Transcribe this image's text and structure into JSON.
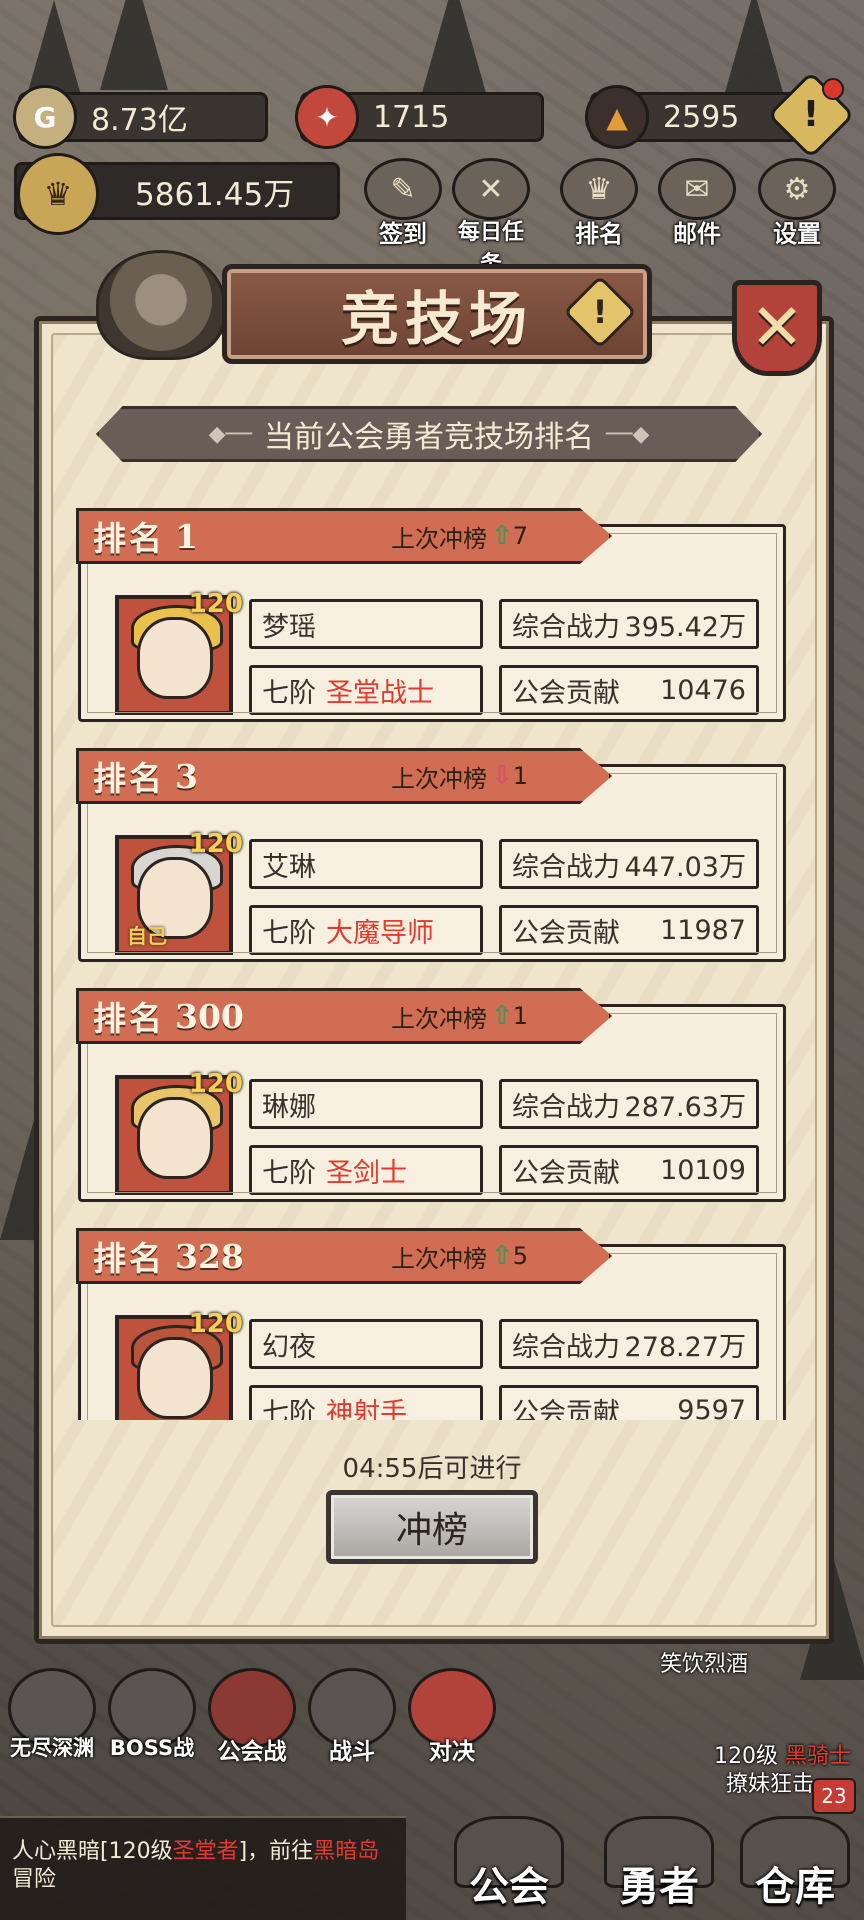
{
  "resources": {
    "gold": "8.73亿",
    "crest": "1715",
    "gem": "2595",
    "alert_icon": "!"
  },
  "power_total": "5861.45万",
  "top_menu": [
    {
      "label": "签到",
      "icon": "quill-icon"
    },
    {
      "label": "每日任务",
      "icon": "scroll-icon"
    },
    {
      "label": "排名",
      "icon": "crown-icon"
    },
    {
      "label": "邮件",
      "icon": "mail-icon"
    },
    {
      "label": "设置",
      "icon": "gear-icon"
    }
  ],
  "modal": {
    "title": "竞技场",
    "help_icon": "!",
    "close_icon": "✕",
    "subtitle": "当前公会勇者竞技场排名",
    "rank_label": "排名",
    "last_label": "上次冲榜",
    "tier_prefix": "七阶",
    "power_label": "综合战力",
    "contrib_label": "公会贡献",
    "entries": [
      {
        "rank": "1",
        "change_dir": "up",
        "change": "7",
        "level": "120",
        "name": "梦瑶",
        "class": "圣堂战士",
        "power": "395.42万",
        "contrib": "10476",
        "hair": "#e9c14d",
        "self": ""
      },
      {
        "rank": "3",
        "change_dir": "down",
        "change": "1",
        "level": "120",
        "name": "艾琳",
        "class": "大魔导师",
        "power": "447.03万",
        "contrib": "11987",
        "hair": "#d9d6d2",
        "self": "自己"
      },
      {
        "rank": "300",
        "change_dir": "up",
        "change": "1",
        "level": "120",
        "name": "琳娜",
        "class": "圣剑士",
        "power": "287.63万",
        "contrib": "10109",
        "hair": "#e8c46a",
        "self": ""
      },
      {
        "rank": "328",
        "change_dir": "up",
        "change": "5",
        "level": "120",
        "name": "幻夜",
        "class": "神射手",
        "power": "278.27万",
        "contrib": "9597",
        "hair": "#b9553a",
        "self": ""
      }
    ],
    "timer": "04:55后可进行",
    "climb_button": "冲榜"
  },
  "bottom_menu": [
    {
      "label": "无尽深渊"
    },
    {
      "label": "BOSS战"
    },
    {
      "label": "公会战"
    },
    {
      "label": "战斗"
    },
    {
      "label": "对决"
    }
  ],
  "npc": {
    "name": "笑饮烈酒",
    "level": "120级",
    "class": "黑骑士",
    "sub": "撩妹狂击",
    "badge": "23"
  },
  "chat": {
    "line1_a": "人心黑暗[120级",
    "line1_b": "圣堂者",
    "line1_c": "]，前往",
    "line1_d": "黑暗岛",
    "line2": "冒险"
  },
  "nav": [
    {
      "label": "公会"
    },
    {
      "label": "勇者"
    },
    {
      "label": "仓库"
    }
  ]
}
